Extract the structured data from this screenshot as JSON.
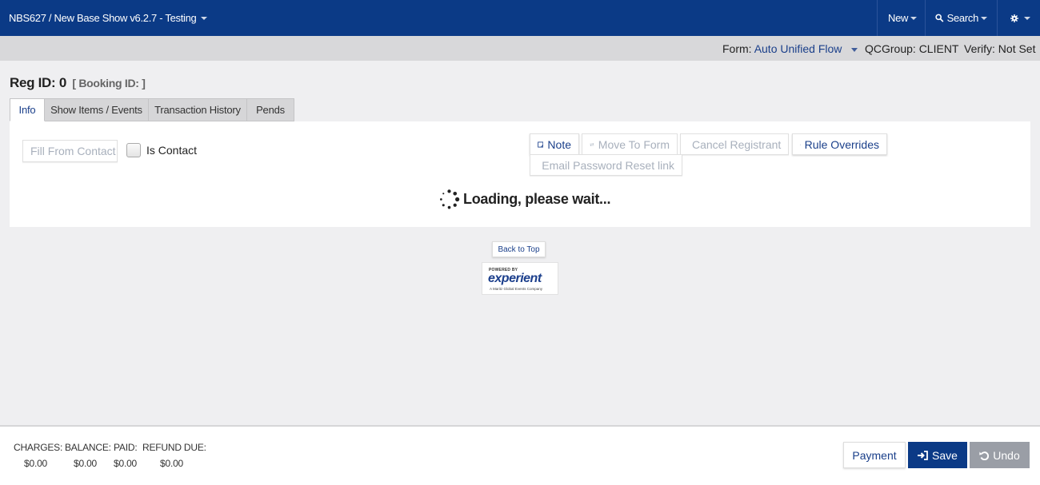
{
  "topbar": {
    "title": "NBS627 / New Base Show v6.2.7 - Testing",
    "new_label": "New",
    "search_label": "Search"
  },
  "subbar": {
    "form_label": "Form:",
    "form_value": "Auto Unified Flow",
    "qcgroup": "QCGroup: CLIENT",
    "verify": "Verify: Not Set"
  },
  "header": {
    "reg_id": "Reg ID: 0",
    "booking_id": "[ Booking ID: ]"
  },
  "tabs": [
    {
      "label": "Info",
      "active": true
    },
    {
      "label": "Show Items / Events",
      "active": false
    },
    {
      "label": "Transaction History",
      "active": false
    },
    {
      "label": "Pends",
      "active": false
    }
  ],
  "panel": {
    "fill_from_contact": "Fill From Contact",
    "is_contact_label": "Is Contact",
    "is_contact_checked": false,
    "note": "Note",
    "move_to_form": "Move To Form",
    "cancel_registrant": "Cancel Registrant",
    "rule_overrides": "Rule Overrides",
    "email_password_reset": "Email Password Reset link",
    "loading": "Loading, please wait..."
  },
  "back_to_top": "Back to Top",
  "logo": {
    "powered_by": "POWERED BY",
    "name": "experient",
    "tagline": "A Maritz Global Events Company"
  },
  "footer": {
    "charges_label": "CHARGES:",
    "charges_value": "$0.00",
    "balance_label": "BALANCE:",
    "balance_value": "$0.00",
    "paid_label": "PAID:",
    "paid_value": "$0.00",
    "refund_label": "REFUND DUE:",
    "refund_value": "$0.00",
    "payment": "Payment",
    "save": "Save",
    "undo": "Undo"
  },
  "colors": {
    "navbar": "#0b3a86",
    "accent": "#1a3f8a",
    "undo_button": "#9a9ea6"
  },
  "icons": [
    "caret-down-icon",
    "search-icon",
    "gear-icon",
    "note-icon",
    "arrows-icon",
    "close-icon",
    "lock-icon",
    "envelope-icon",
    "spinner-icon",
    "sign-in-icon",
    "undo-icon"
  ]
}
